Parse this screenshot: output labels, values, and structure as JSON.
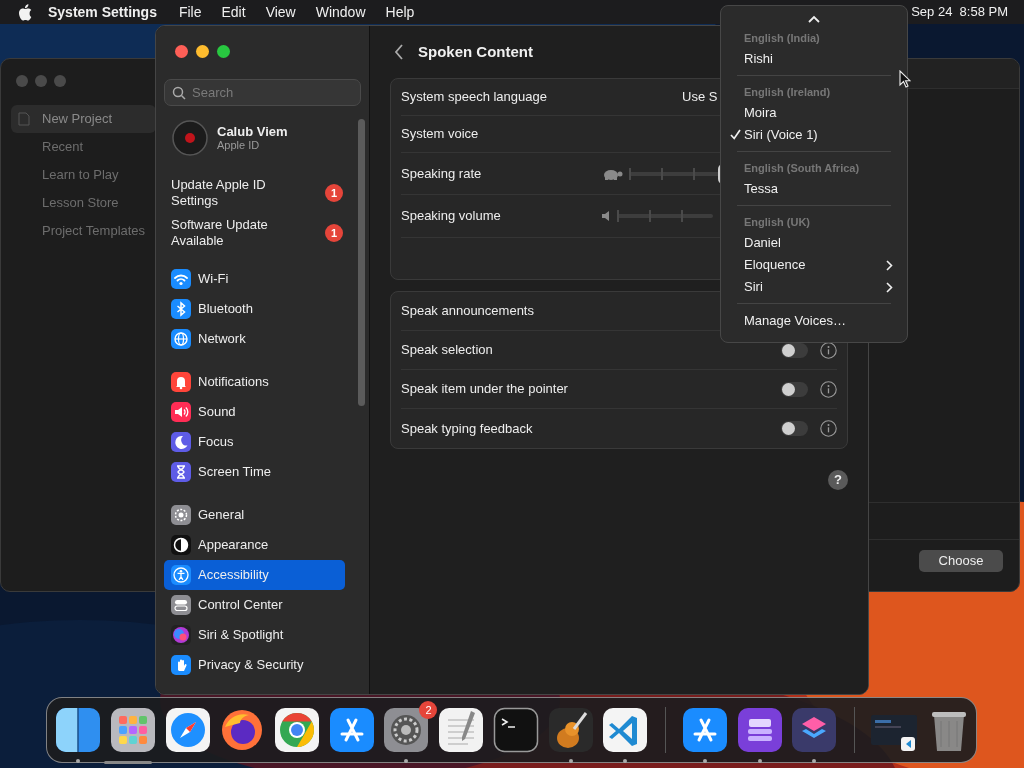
{
  "menu_bar": {
    "app_name": "System Settings",
    "menus": [
      "File",
      "Edit",
      "View",
      "Window",
      "Help"
    ],
    "clock": "Sep 24  8:58 PM"
  },
  "background_window": {
    "sidebar": [
      {
        "label": "New Project",
        "selected": true
      },
      {
        "label": "Recent",
        "selected": false
      },
      {
        "label": "Learn to Play",
        "selected": false
      },
      {
        "label": "Lesson Store",
        "selected": false
      },
      {
        "label": "Project Templates",
        "selected": false
      }
    ],
    "button": "Choose"
  },
  "settings_window": {
    "search": {
      "placeholder": "Search"
    },
    "account": {
      "name": "Calub Viem",
      "subtitle": "Apple ID"
    },
    "alerts": [
      {
        "label": "Update Apple ID Settings",
        "badge": "1"
      },
      {
        "label": "Software Update Available",
        "badge": "1"
      }
    ],
    "sidebar_groups": [
      [
        {
          "label": "Wi-Fi",
          "kind": "wifi",
          "selected": false
        },
        {
          "label": "Bluetooth",
          "kind": "bluetooth",
          "selected": false
        },
        {
          "label": "Network",
          "kind": "network",
          "selected": false
        }
      ],
      [
        {
          "label": "Notifications",
          "kind": "notifications",
          "selected": false
        },
        {
          "label": "Sound",
          "kind": "sound",
          "selected": false
        },
        {
          "label": "Focus",
          "kind": "focus",
          "selected": false
        },
        {
          "label": "Screen Time",
          "kind": "screentime",
          "selected": false
        }
      ],
      [
        {
          "label": "General",
          "kind": "general",
          "selected": false
        },
        {
          "label": "Appearance",
          "kind": "appearance",
          "selected": false
        },
        {
          "label": "Accessibility",
          "kind": "accessibility",
          "selected": true
        },
        {
          "label": "Control Center",
          "kind": "control",
          "selected": false
        },
        {
          "label": "Siri & Spotlight",
          "kind": "siri",
          "selected": false
        },
        {
          "label": "Privacy & Security",
          "kind": "privacy",
          "selected": false
        }
      ]
    ],
    "title": "Spoken Content",
    "voice_settings": [
      {
        "kind": "value",
        "label": "System speech language",
        "value": "Use S"
      },
      {
        "kind": "plain",
        "label": "System voice"
      },
      {
        "kind": "rate",
        "label": "Speaking rate",
        "level": 0.98
      },
      {
        "kind": "volume",
        "label": "Speaking volume"
      },
      {
        "kind": "blank"
      }
    ],
    "speak_options": [
      {
        "label": "Speak announcements"
      },
      {
        "label": "Speak selection",
        "on": false
      },
      {
        "label": "Speak item under the pointer",
        "on": false
      },
      {
        "label": "Speak typing feedback",
        "on": false
      }
    ],
    "help_button": "?"
  },
  "voice_menu": {
    "sections": [
      {
        "header": "English (India)",
        "items": [
          {
            "label": "Rishi",
            "checked": false,
            "submenu": false
          }
        ]
      },
      {
        "header": "English (Ireland)",
        "items": [
          {
            "label": "Moira",
            "checked": false,
            "submenu": false
          },
          {
            "label": "Siri (Voice 1)",
            "checked": true,
            "submenu": false
          }
        ]
      },
      {
        "header": "English (South Africa)",
        "items": [
          {
            "label": "Tessa",
            "checked": false,
            "submenu": false
          }
        ]
      },
      {
        "header": "English (UK)",
        "items": [
          {
            "label": "Daniel",
            "checked": false,
            "submenu": false
          },
          {
            "label": "Eloquence",
            "checked": false,
            "submenu": true
          },
          {
            "label": "Siri",
            "checked": false,
            "submenu": true
          }
        ]
      }
    ],
    "footer": "Manage Voices…"
  },
  "dock": {
    "groups": [
      [
        {
          "kind": "finder",
          "running": true
        },
        {
          "kind": "launchpad",
          "running": false
        },
        {
          "kind": "safari",
          "running": false
        },
        {
          "kind": "firefox",
          "running": false
        },
        {
          "kind": "chrome",
          "running": false
        },
        {
          "kind": "appstore",
          "running": false
        },
        {
          "kind": "settings",
          "running": true,
          "badge": "2"
        },
        {
          "kind": "textedit",
          "running": false
        },
        {
          "kind": "terminal",
          "running": false
        },
        {
          "kind": "guitar",
          "running": true
        },
        {
          "kind": "vscode",
          "running": true
        }
      ],
      [
        {
          "kind": "appstore",
          "running": true
        },
        {
          "kind": "drive",
          "running": true
        },
        {
          "kind": "shortcuts",
          "running": true
        }
      ],
      [
        {
          "kind": "window",
          "running": false
        },
        {
          "kind": "trash",
          "running": false
        }
      ]
    ]
  }
}
